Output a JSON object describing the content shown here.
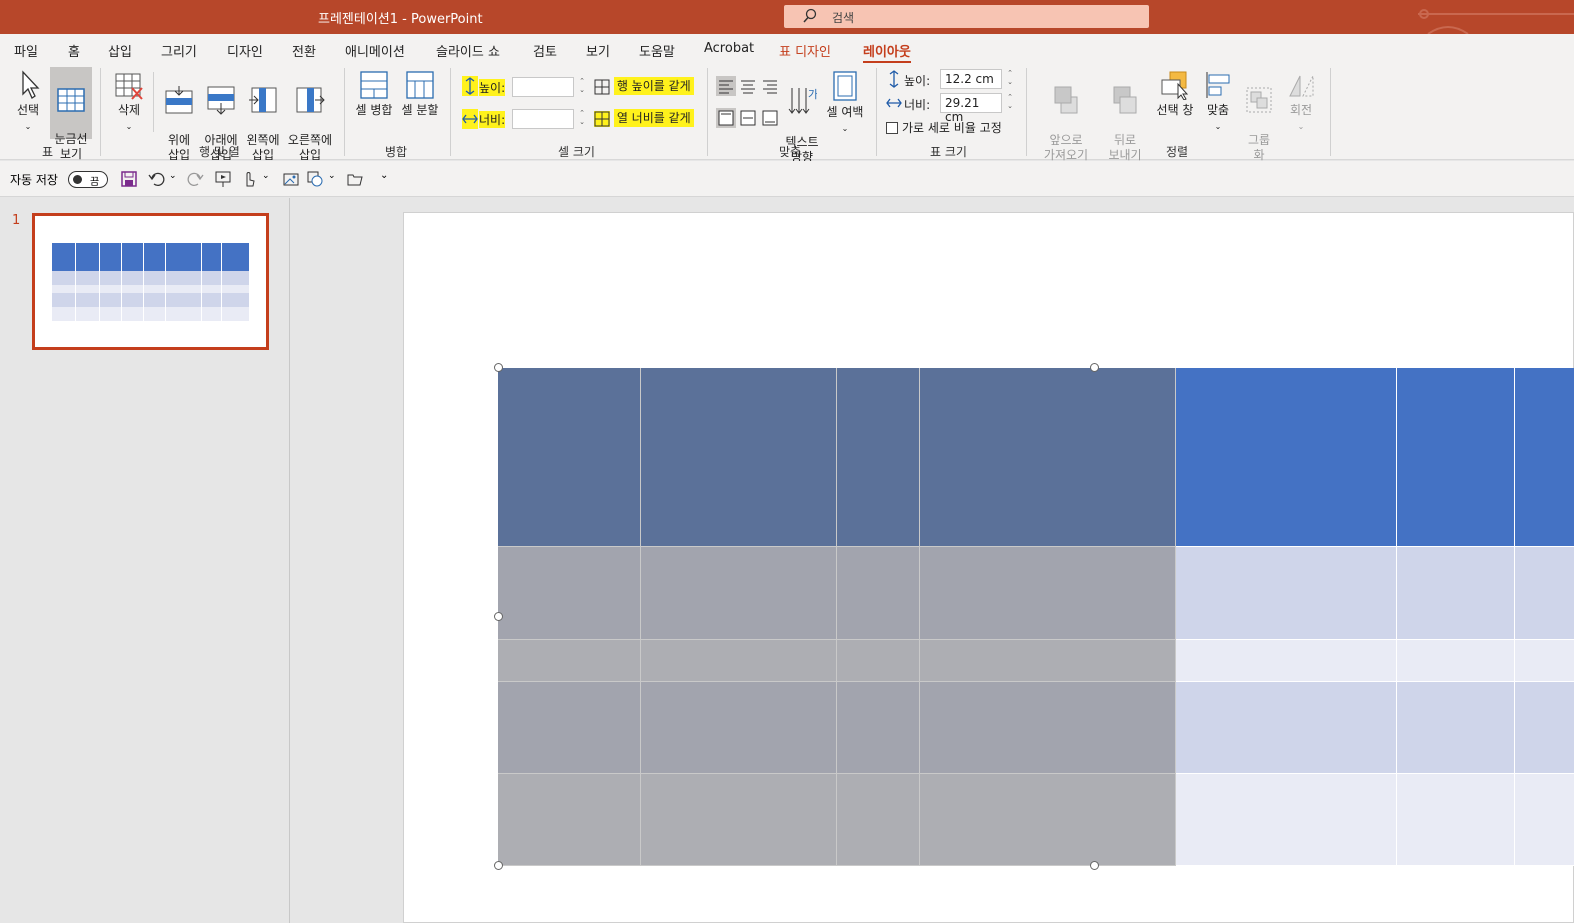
{
  "titlebar": {
    "title": "프레젠테이션1  -  PowerPoint",
    "search_placeholder": "검색"
  },
  "menu": [
    "파일",
    "홈",
    "삽입",
    "그리기",
    "디자인",
    "전환",
    "애니메이션",
    "슬라이드 쇼",
    "검토",
    "보기",
    "도움말",
    "Acrobat",
    "표 디자인",
    "레이아웃"
  ],
  "ribbon": {
    "table_group": {
      "label": "표",
      "select": "선택",
      "gridlines": "눈금선\n보기"
    },
    "rows_cols_group": {
      "label": "행 및 열",
      "delete": "삭제",
      "insert_above": "위에\n삽입",
      "insert_below": "아래에\n삽입",
      "insert_left": "왼쪽에\n삽입",
      "insert_right": "오른쪽에\n삽입"
    },
    "merge_group": {
      "label": "병합",
      "merge_cells": "셀 병합",
      "split_cells": "셀 분할"
    },
    "cell_size_group": {
      "label": "셀 크기",
      "height_label": "높이:",
      "width_label": "너비:",
      "height_value": "",
      "width_value": "",
      "distribute_rows": "행 높이를 같게",
      "distribute_cols": "열 너비를 같게"
    },
    "alignment_group": {
      "label": "맞춤",
      "text_direction": "텍스트\n방향",
      "cell_margins": "셀 여백"
    },
    "table_size_group": {
      "label": "표 크기",
      "height_label": "높이:",
      "width_label": "너비:",
      "height_value": "12.2 cm",
      "width_value": "29.21 cm",
      "lock_aspect": "가로 세로 비율 고정"
    },
    "arrange_group": {
      "label": "정렬",
      "bring_forward": "앞으로\n가져오기",
      "send_backward": "뒤로\n보내기",
      "selection_pane": "선택 창",
      "align": "맞춤",
      "group": "그룹\n화",
      "rotate": "회전"
    }
  },
  "qat": {
    "autosave_label": "자동 저장",
    "autosave_state": "끔"
  },
  "slides_pane": {
    "slide_number": "1"
  },
  "colors": {
    "accent": "#b7472a",
    "header_selected": "#5b7199",
    "header": "#4472c4",
    "band_dark": "#cfd5ea",
    "band_light": "#e9ebf5",
    "body_selected_dark": "#a2a4ae",
    "body_selected_light": "#adaeb3"
  }
}
